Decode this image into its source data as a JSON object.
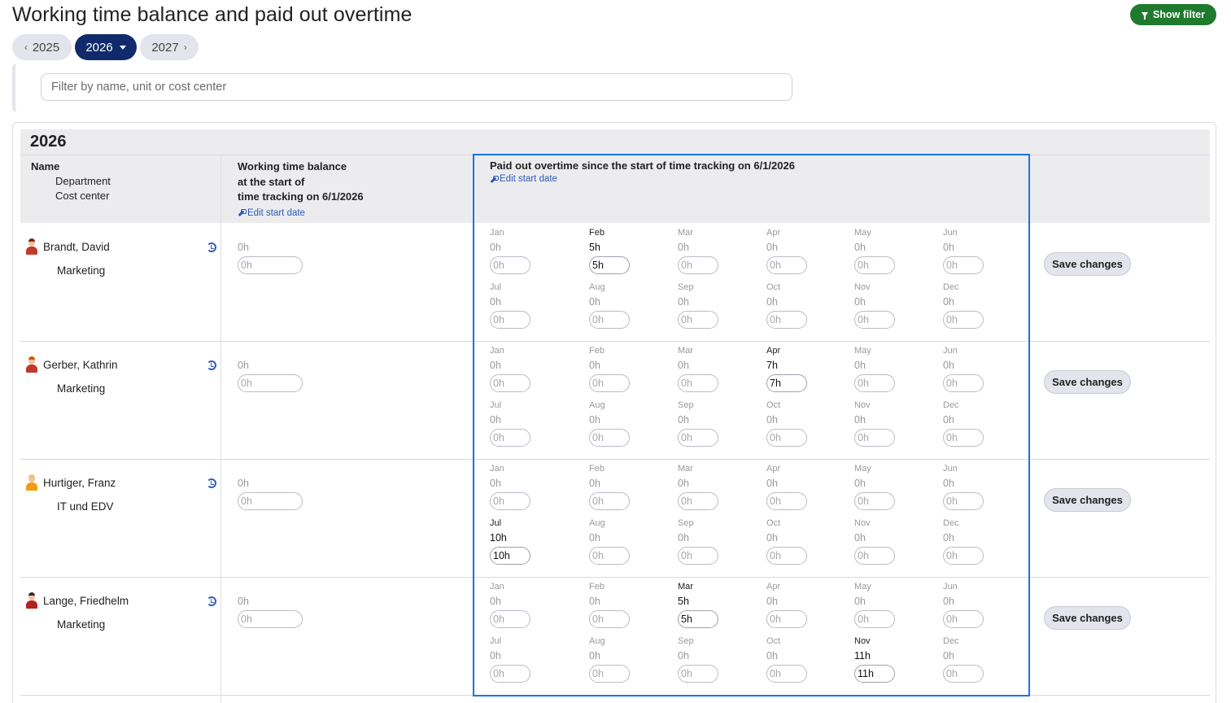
{
  "page": {
    "title": "Working time balance and paid out overtime"
  },
  "toolbar": {
    "show_filter_label": "Show filter"
  },
  "year_nav": {
    "prev": "2025",
    "current": "2026",
    "next": "2027"
  },
  "search": {
    "placeholder": "Filter by name, unit or cost center",
    "value": ""
  },
  "table": {
    "year": "2026",
    "headers": {
      "name": "Name",
      "department": "Department",
      "cost_center": "Cost center",
      "balance_line1": "Working time balance",
      "balance_line2": "at the start of",
      "balance_line3": "time tracking on 6/1/2026",
      "edit_start_date": "Edit start date",
      "overtime": "Paid out overtime since the start of time tracking on 6/1/2026"
    },
    "save_label": "Save changes",
    "months": [
      "Jan",
      "Feb",
      "Mar",
      "Apr",
      "May",
      "Jun",
      "Jul",
      "Aug",
      "Sep",
      "Oct",
      "Nov",
      "Dec"
    ],
    "placeholder": "0h",
    "rows": [
      {
        "name": "Brandt, David",
        "unit": "Marketing",
        "balance": "0h",
        "balance_input": "",
        "values": [
          "0h",
          "5h",
          "0h",
          "0h",
          "0h",
          "0h",
          "0h",
          "0h",
          "0h",
          "0h",
          "0h",
          "0h"
        ],
        "inputs": [
          "",
          "5h",
          "",
          "",
          "",
          "",
          "",
          "",
          "",
          "",
          "",
          ""
        ]
      },
      {
        "name": "Gerber, Kathrin",
        "unit": "Marketing",
        "balance": "0h",
        "balance_input": "",
        "values": [
          "0h",
          "0h",
          "0h",
          "7h",
          "0h",
          "0h",
          "0h",
          "0h",
          "0h",
          "0h",
          "0h",
          "0h"
        ],
        "inputs": [
          "",
          "",
          "",
          "7h",
          "",
          "",
          "",
          "",
          "",
          "",
          "",
          ""
        ]
      },
      {
        "name": "Hurtiger, Franz",
        "unit": "IT und EDV",
        "balance": "0h",
        "balance_input": "",
        "values": [
          "0h",
          "0h",
          "0h",
          "0h",
          "0h",
          "0h",
          "10h",
          "0h",
          "0h",
          "0h",
          "0h",
          "0h"
        ],
        "inputs": [
          "",
          "",
          "",
          "",
          "",
          "",
          "10h",
          "",
          "",
          "",
          "",
          ""
        ]
      },
      {
        "name": "Lange, Friedhelm",
        "unit": "Marketing",
        "balance": "0h",
        "balance_input": "",
        "values": [
          "0h",
          "0h",
          "5h",
          "0h",
          "0h",
          "0h",
          "0h",
          "0h",
          "0h",
          "0h",
          "11h",
          "0h"
        ],
        "inputs": [
          "",
          "",
          "5h",
          "",
          "",
          "",
          "",
          "",
          "",
          "",
          "11h",
          ""
        ]
      }
    ]
  },
  "colors": {
    "accent": "#102a6b",
    "success": "#1e7a2c",
    "highlight": "#1a73e8",
    "link": "#2a5bb8"
  }
}
